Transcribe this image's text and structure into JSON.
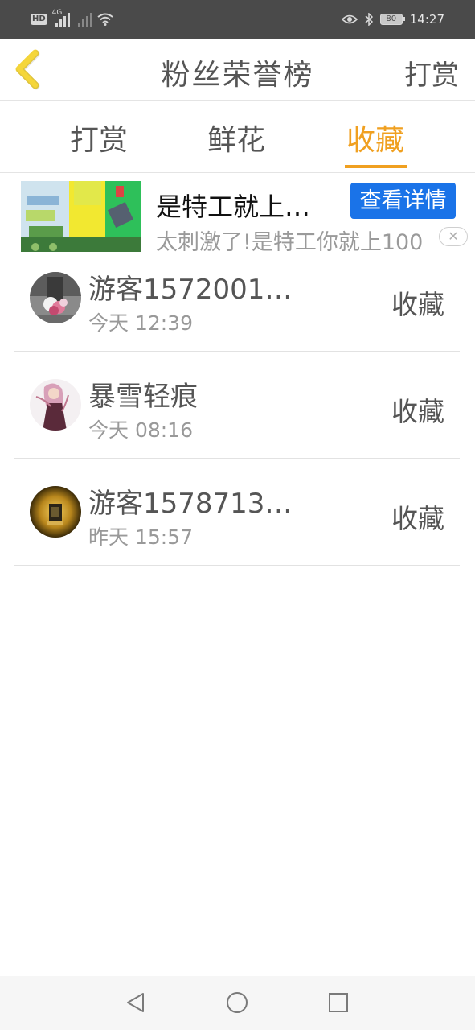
{
  "status_bar": {
    "hd_label": "HD",
    "network_label": "4G",
    "time": "14:27",
    "battery": "80",
    "icons": [
      "hd-icon",
      "signal-icon",
      "wifi-icon",
      "eye-icon",
      "bluetooth-icon",
      "battery-icon"
    ]
  },
  "header": {
    "back_icon": "chevron-left-icon",
    "title": "粉丝荣誉榜",
    "right_action": "打赏"
  },
  "tabs": [
    {
      "label": "打赏",
      "active": false
    },
    {
      "label": "鲜花",
      "active": false
    },
    {
      "label": "收藏",
      "active": true
    }
  ],
  "ad": {
    "title": "是特工就上…",
    "button": "查看详情",
    "description": "太刺激了!是特工你就上100",
    "close_icon": "close-icon"
  },
  "fans": [
    {
      "name": "游客1572001…",
      "time": "今天 12:39",
      "action": "收藏"
    },
    {
      "name": "暴雪轻痕",
      "time": "今天 08:16",
      "action": "收藏"
    },
    {
      "name": "游客1578713…",
      "time": "昨天 15:57",
      "action": "收藏"
    }
  ],
  "nav_bar": {
    "icons": [
      "back-triangle-icon",
      "home-circle-icon",
      "recent-square-icon"
    ]
  },
  "colors": {
    "accent": "#f0a020",
    "ad_button": "#1a73e8",
    "status_bar": "#4a4a4a",
    "text": "#555555",
    "muted": "#999999"
  }
}
